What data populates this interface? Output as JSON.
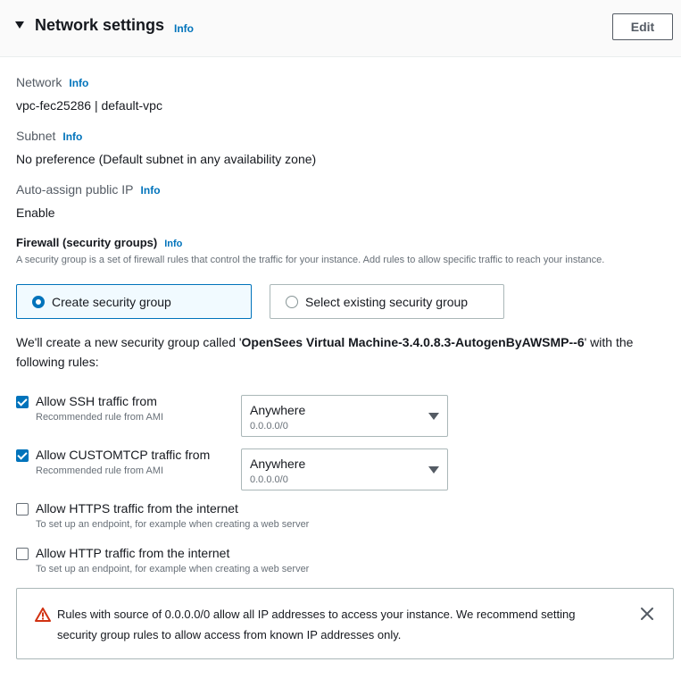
{
  "header": {
    "title": "Network settings",
    "info": "Info",
    "edit_label": "Edit"
  },
  "network": {
    "label": "Network",
    "info": "Info",
    "value": "vpc-fec25286 | default-vpc"
  },
  "subnet": {
    "label": "Subnet",
    "info": "Info",
    "value": "No preference (Default subnet in any availability zone)"
  },
  "public_ip": {
    "label": "Auto-assign public IP",
    "info": "Info",
    "value": "Enable"
  },
  "firewall": {
    "label": "Firewall (security groups)",
    "info": "Info",
    "description": "A security group is a set of firewall rules that control the traffic for your instance. Add rules to allow specific traffic to reach your instance.",
    "options": [
      {
        "label": "Create security group",
        "selected": true
      },
      {
        "label": "Select existing security group",
        "selected": false
      }
    ],
    "create_desc_prefix": "We'll create a new security group called '",
    "group_name": "OpenSees Virtual Machine-3.4.0.8.3-AutogenByAWSMP--6",
    "create_desc_suffix": "' with the following rules:"
  },
  "rules": [
    {
      "label": "Allow SSH traffic from",
      "sub": "Recommended rule from AMI",
      "checked": true,
      "select_value": "Anywhere",
      "select_sub": "0.0.0.0/0"
    },
    {
      "label": "Allow CUSTOMTCP traffic from",
      "sub": "Recommended rule from AMI",
      "checked": true,
      "select_value": "Anywhere",
      "select_sub": "0.0.0.0/0"
    },
    {
      "label": "Allow HTTPS traffic from the internet",
      "sub": "To set up an endpoint, for example when creating a web server",
      "checked": false
    },
    {
      "label": "Allow HTTP traffic from the internet",
      "sub": "To set up an endpoint, for example when creating a web server",
      "checked": false
    }
  ],
  "alert": {
    "text": "Rules with source of 0.0.0.0/0 allow all IP addresses to access your instance. We recommend setting security group rules to allow access from known IP addresses only.",
    "icon": "warning-icon",
    "close_icon": "close-icon"
  },
  "colors": {
    "accent": "#0073bb",
    "warning": "#d13212",
    "text": "#16191f",
    "muted": "#687078"
  }
}
